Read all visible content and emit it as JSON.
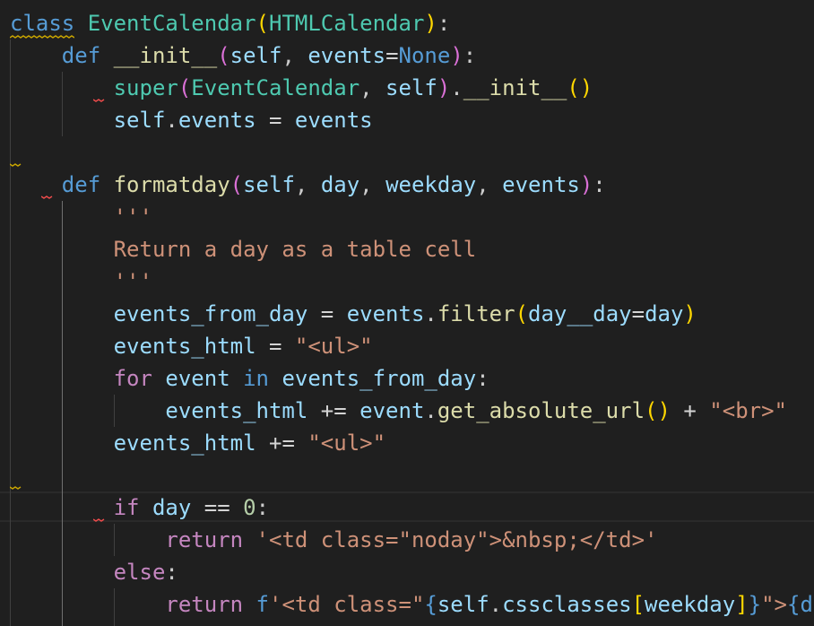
{
  "code_lines": [
    [
      {
        "t": "class",
        "c": "#569cd6"
      },
      {
        "t": " ",
        "c": "#cccccc"
      },
      {
        "t": "EventCalendar",
        "c": "#4ec9b0"
      },
      {
        "t": "(",
        "c": "#ffd700"
      },
      {
        "t": "HTMLCalendar",
        "c": "#4ec9b0"
      },
      {
        "t": ")",
        "c": "#ffd700"
      },
      {
        "t": ":",
        "c": "#cccccc"
      }
    ],
    [
      {
        "t": "    ",
        "c": "#cccccc"
      },
      {
        "t": "def",
        "c": "#569cd6"
      },
      {
        "t": " ",
        "c": "#cccccc"
      },
      {
        "t": "__init__",
        "c": "#dcdcaa"
      },
      {
        "t": "(",
        "c": "#da70d6"
      },
      {
        "t": "self",
        "c": "#9cdcfe"
      },
      {
        "t": ", ",
        "c": "#cccccc"
      },
      {
        "t": "events",
        "c": "#9cdcfe"
      },
      {
        "t": "=",
        "c": "#d4d4d4"
      },
      {
        "t": "None",
        "c": "#569cd6"
      },
      {
        "t": ")",
        "c": "#da70d6"
      },
      {
        "t": ":",
        "c": "#cccccc"
      }
    ],
    [
      {
        "t": "        ",
        "c": "#cccccc"
      },
      {
        "t": "super",
        "c": "#4ec9b0"
      },
      {
        "t": "(",
        "c": "#da70d6"
      },
      {
        "t": "EventCalendar",
        "c": "#4ec9b0"
      },
      {
        "t": ", ",
        "c": "#cccccc"
      },
      {
        "t": "self",
        "c": "#9cdcfe"
      },
      {
        "t": ")",
        "c": "#da70d6"
      },
      {
        "t": ".",
        "c": "#cccccc"
      },
      {
        "t": "__init__",
        "c": "#dcdcaa"
      },
      {
        "t": "()",
        "c": "#ffd700"
      }
    ],
    [
      {
        "t": "        ",
        "c": "#cccccc"
      },
      {
        "t": "self",
        "c": "#9cdcfe"
      },
      {
        "t": ".",
        "c": "#cccccc"
      },
      {
        "t": "events",
        "c": "#9cdcfe"
      },
      {
        "t": " = ",
        "c": "#d4d4d4"
      },
      {
        "t": "events",
        "c": "#9cdcfe"
      }
    ],
    [],
    [
      {
        "t": "    ",
        "c": "#cccccc"
      },
      {
        "t": "def",
        "c": "#569cd6"
      },
      {
        "t": " ",
        "c": "#cccccc"
      },
      {
        "t": "formatday",
        "c": "#dcdcaa"
      },
      {
        "t": "(",
        "c": "#da70d6"
      },
      {
        "t": "self",
        "c": "#9cdcfe"
      },
      {
        "t": ", ",
        "c": "#cccccc"
      },
      {
        "t": "day",
        "c": "#9cdcfe"
      },
      {
        "t": ", ",
        "c": "#cccccc"
      },
      {
        "t": "weekday",
        "c": "#9cdcfe"
      },
      {
        "t": ", ",
        "c": "#cccccc"
      },
      {
        "t": "events",
        "c": "#9cdcfe"
      },
      {
        "t": ")",
        "c": "#da70d6"
      },
      {
        "t": ":",
        "c": "#cccccc"
      }
    ],
    [
      {
        "t": "        ",
        "c": "#cccccc"
      },
      {
        "t": "'''",
        "c": "#ce9178"
      }
    ],
    [
      {
        "t": "        ",
        "c": "#cccccc"
      },
      {
        "t": "Return a day as a table cell",
        "c": "#ce9178"
      }
    ],
    [
      {
        "t": "        ",
        "c": "#cccccc"
      },
      {
        "t": "'''",
        "c": "#ce9178"
      }
    ],
    [
      {
        "t": "        ",
        "c": "#cccccc"
      },
      {
        "t": "events_from_day",
        "c": "#9cdcfe"
      },
      {
        "t": " = ",
        "c": "#d4d4d4"
      },
      {
        "t": "events",
        "c": "#9cdcfe"
      },
      {
        "t": ".",
        "c": "#cccccc"
      },
      {
        "t": "filter",
        "c": "#dcdcaa"
      },
      {
        "t": "(",
        "c": "#ffd700"
      },
      {
        "t": "day__day",
        "c": "#9cdcfe"
      },
      {
        "t": "=",
        "c": "#d4d4d4"
      },
      {
        "t": "day",
        "c": "#9cdcfe"
      },
      {
        "t": ")",
        "c": "#ffd700"
      }
    ],
    [
      {
        "t": "        ",
        "c": "#cccccc"
      },
      {
        "t": "events_html",
        "c": "#9cdcfe"
      },
      {
        "t": " = ",
        "c": "#d4d4d4"
      },
      {
        "t": "\"<ul>\"",
        "c": "#ce9178"
      }
    ],
    [
      {
        "t": "        ",
        "c": "#cccccc"
      },
      {
        "t": "for",
        "c": "#c586c0"
      },
      {
        "t": " ",
        "c": "#cccccc"
      },
      {
        "t": "event",
        "c": "#9cdcfe"
      },
      {
        "t": " ",
        "c": "#cccccc"
      },
      {
        "t": "in",
        "c": "#569cd6"
      },
      {
        "t": " ",
        "c": "#cccccc"
      },
      {
        "t": "events_from_day",
        "c": "#9cdcfe"
      },
      {
        "t": ":",
        "c": "#cccccc"
      }
    ],
    [
      {
        "t": "            ",
        "c": "#cccccc"
      },
      {
        "t": "events_html",
        "c": "#9cdcfe"
      },
      {
        "t": " += ",
        "c": "#d4d4d4"
      },
      {
        "t": "event",
        "c": "#9cdcfe"
      },
      {
        "t": ".",
        "c": "#cccccc"
      },
      {
        "t": "get_absolute_url",
        "c": "#dcdcaa"
      },
      {
        "t": "()",
        "c": "#ffd700"
      },
      {
        "t": " + ",
        "c": "#d4d4d4"
      },
      {
        "t": "\"<br>\"",
        "c": "#ce9178"
      }
    ],
    [
      {
        "t": "        ",
        "c": "#cccccc"
      },
      {
        "t": "events_html",
        "c": "#9cdcfe"
      },
      {
        "t": " += ",
        "c": "#d4d4d4"
      },
      {
        "t": "\"<ul>\"",
        "c": "#ce9178"
      }
    ],
    [],
    [
      {
        "t": "        ",
        "c": "#cccccc"
      },
      {
        "t": "if",
        "c": "#c586c0"
      },
      {
        "t": " ",
        "c": "#cccccc"
      },
      {
        "t": "day",
        "c": "#9cdcfe"
      },
      {
        "t": " == ",
        "c": "#d4d4d4"
      },
      {
        "t": "0",
        "c": "#b5cea8"
      },
      {
        "t": ":",
        "c": "#cccccc"
      }
    ],
    [
      {
        "t": "            ",
        "c": "#cccccc"
      },
      {
        "t": "return",
        "c": "#c586c0"
      },
      {
        "t": " ",
        "c": "#cccccc"
      },
      {
        "t": "'<td class=\"noday\">&nbsp;</td>'",
        "c": "#ce9178"
      }
    ],
    [
      {
        "t": "        ",
        "c": "#cccccc"
      },
      {
        "t": "else",
        "c": "#c586c0"
      },
      {
        "t": ":",
        "c": "#cccccc"
      }
    ],
    [
      {
        "t": "            ",
        "c": "#cccccc"
      },
      {
        "t": "return",
        "c": "#c586c0"
      },
      {
        "t": " ",
        "c": "#cccccc"
      },
      {
        "t": "f",
        "c": "#569cd6"
      },
      {
        "t": "'<td class=\"",
        "c": "#ce9178"
      },
      {
        "t": "{",
        "c": "#569cd6"
      },
      {
        "t": "self",
        "c": "#9cdcfe"
      },
      {
        "t": ".",
        "c": "#cccccc"
      },
      {
        "t": "cssclasses",
        "c": "#9cdcfe"
      },
      {
        "t": "[",
        "c": "#ffd700"
      },
      {
        "t": "weekday",
        "c": "#9cdcfe"
      },
      {
        "t": "]",
        "c": "#ffd700"
      },
      {
        "t": "}",
        "c": "#569cd6"
      },
      {
        "t": "\">",
        "c": "#ce9178"
      },
      {
        "t": "{da",
        "c": "#569cd6"
      }
    ]
  ],
  "colors": {
    "background": "#1f1f1f",
    "indent_guide": "#404040",
    "indent_guide_active": "#707070",
    "warning_squiggle": "#cca700",
    "error_squiggle": "#f14c4c"
  }
}
